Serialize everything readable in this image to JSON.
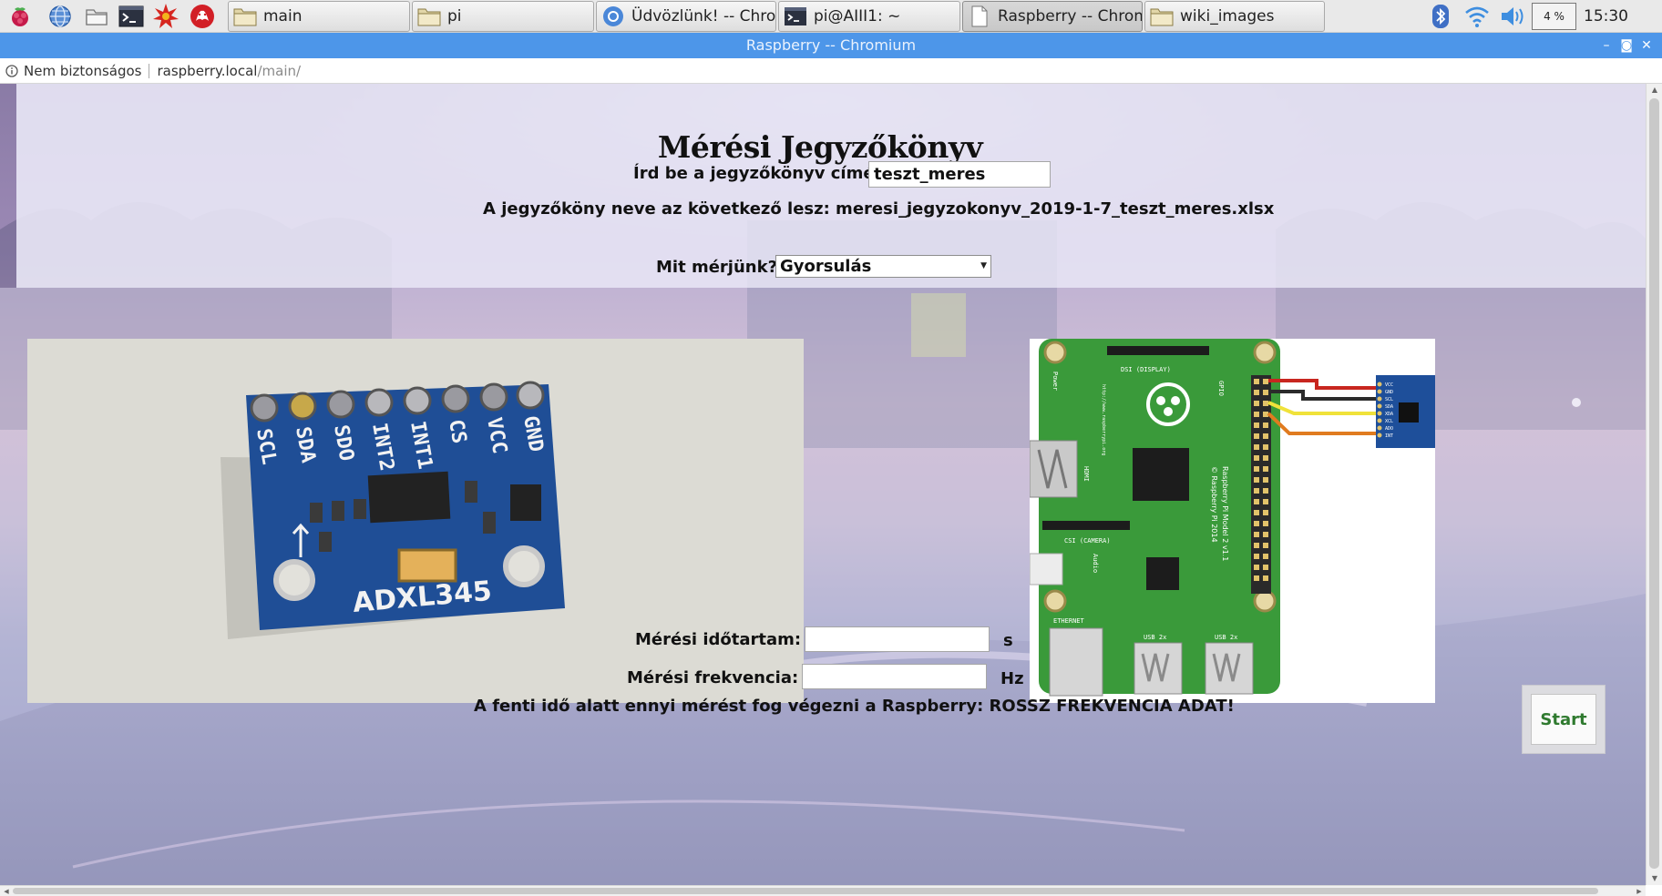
{
  "taskbar": {
    "tasks": [
      {
        "label": "main",
        "icon": "folder-icon"
      },
      {
        "label": "pi",
        "icon": "folder-icon"
      },
      {
        "label": "Üdvözlünk! -- Chromi...",
        "icon": "chromium-icon"
      },
      {
        "label": "pi@AIII1: ~",
        "icon": "terminal-icon"
      },
      {
        "label": "Raspberry -- Chromiu...",
        "icon": "page-icon"
      },
      {
        "label": "wiki_images",
        "icon": "folder-icon"
      }
    ],
    "cpu": "4 %",
    "clock": "15:30"
  },
  "window": {
    "title": "Raspberry -- Chromium",
    "controls": {
      "minimize": "–",
      "maximize": "◙",
      "close": "✕"
    }
  },
  "address": {
    "security": "Nem biztonságos",
    "host": "raspberry.local",
    "path": "/main/"
  },
  "page": {
    "title": "Mérési Jegyzőkönyv",
    "title_label": "Írd be a jegyzőkönyv címét:",
    "title_value": "teszt_meres",
    "filename_line": "A jegyzőköny neve az következő lesz: meresi_jegyzokonyv_2019-1-7_teszt_meres.xlsx",
    "measure_label": "Mit mérjünk?",
    "measure_selected": "Gyorsulás",
    "sensor_pins": [
      "SCL",
      "SDA",
      "SDO",
      "INT2",
      "INT1",
      "CS",
      "VCC",
      "GND"
    ],
    "sensor_model": "ADXL345",
    "pcb_labels": {
      "dsi": "DSI (DISPLAY)",
      "hdmi": "HDMI",
      "csi": "CSI (CAMERA)",
      "audio": "Audio",
      "ethernet": "ETHERNET",
      "usb1": "USB 2x",
      "usb2": "USB 2x",
      "gpio": "GPIO",
      "power": "Power",
      "model": "Raspberry Pi Model 2 v1.1",
      "copyright": "© Raspberry Pi 2014",
      "url": "http://www.raspberrypi.org"
    },
    "module_pins": [
      "VCC",
      "GND",
      "SCL",
      "SDA",
      "XDA",
      "XCL",
      "ADO",
      "INT"
    ],
    "duration_label": "Mérési időtartam:",
    "duration_value": "",
    "duration_unit": "s",
    "freq_label": "Mérési frekvencia:",
    "freq_value": "",
    "freq_unit": "Hz",
    "info_line": "A fenti idő alatt ennyi mérést fog végezni a Raspberry: ROSSZ FREKVENCIA ADAT!",
    "start_label": "Start"
  },
  "colors": {
    "title_bar": "#4d96e9",
    "start_text": "#2f7a2f",
    "pcb_green": "#3a9a3a",
    "sensor_blue": "#1e4f9a"
  }
}
